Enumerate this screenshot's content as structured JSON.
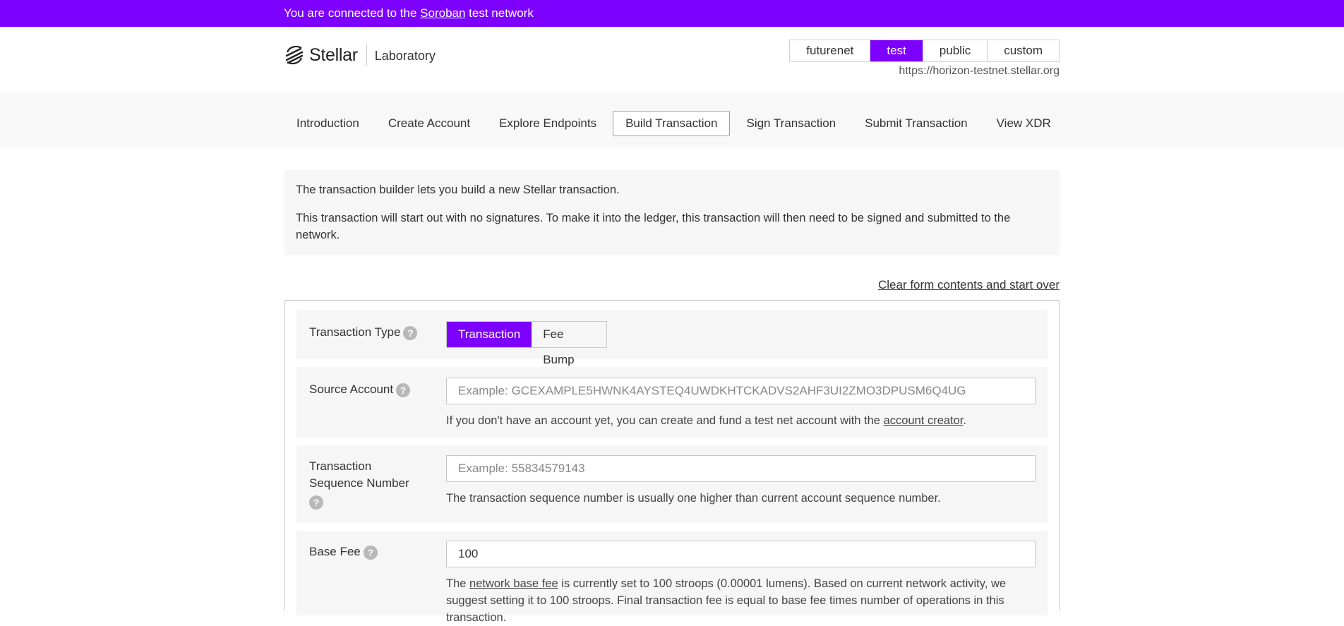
{
  "banner": {
    "prefix": "You are connected to the",
    "link": "Soroban",
    "suffix": "test network"
  },
  "header": {
    "logo_text": "Stellar",
    "logo_sub": "Laboratory",
    "networks": [
      "futurenet",
      "test",
      "public",
      "custom"
    ],
    "active_network": "test",
    "network_url": "https://horizon-testnet.stellar.org"
  },
  "nav": {
    "items": [
      "Introduction",
      "Create Account",
      "Explore Endpoints",
      "Build Transaction",
      "Sign Transaction",
      "Submit Transaction",
      "View XDR"
    ],
    "active": "Build Transaction"
  },
  "intro": {
    "p1": "The transaction builder lets you build a new Stellar transaction.",
    "p2": "This transaction will start out with no signatures. To make it into the ledger, this transaction will then need to be signed and submitted to the network."
  },
  "clear_link": "Clear form contents and start over",
  "form": {
    "type": {
      "label": "Transaction Type",
      "options": [
        "Transaction",
        "Fee Bump"
      ],
      "selected": "Transaction"
    },
    "source": {
      "label": "Source Account",
      "placeholder": "Example: GCEXAMPLE5HWNK4AYSTEQ4UWDKHTCKADVS2AHF3UI2ZMO3DPUSM6Q4UG",
      "hint_prefix": "If you don't have an account yet, you can create and fund a test net account with the",
      "hint_link": "account creator",
      "hint_suffix": "."
    },
    "sequence": {
      "label_line1": "Transaction",
      "label_line2": "Sequence Number",
      "placeholder": "Example: 55834579143",
      "hint": "The transaction sequence number is usually one higher than current account sequence number."
    },
    "base_fee": {
      "label": "Base Fee",
      "value": "100",
      "hint_prefix": "The",
      "hint_link": "network base fee",
      "hint_suffix": "is currently set to 100 stroops (0.00001 lumens). Based on current network activity, we suggest setting it to 100 stroops. Final transaction fee is equal to base fee times number of operations in this transaction."
    }
  },
  "help_glyph": "?",
  "colors": {
    "accent": "#7d00ff"
  }
}
